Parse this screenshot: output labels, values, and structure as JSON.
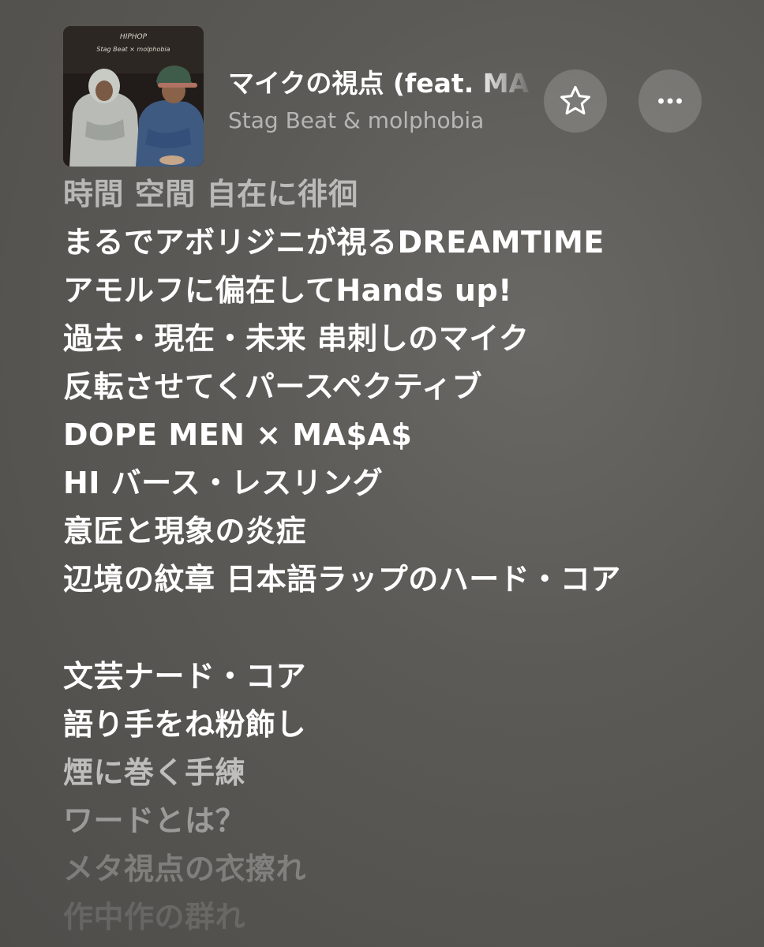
{
  "now_playing": {
    "title": "マイクの視点 (feat. MA",
    "artist": "Stag Beat & molphobia",
    "artwork_caption": "HIPHOP",
    "artwork_caption_2": "Stag Beat × molphobia"
  },
  "controls": {
    "favorite_icon": "star-outline-icon",
    "more_icon": "ellipsis-icon"
  },
  "colors": {
    "background": "#5c5a56",
    "button_bg": "rgba(255,255,255,0.17)",
    "active_text": "#ffffff",
    "secondary_text": "rgba(255,255,255,0.55)"
  },
  "lyrics": {
    "verse1": [
      "時間 空間 自在に徘徊",
      "まるでアボリジニが視るDREAMTIME",
      "アモルフに偏在してHands up!",
      "過去・現在・未来 串刺しのマイク",
      "反転させてくパースペクティブ",
      "DOPE MEN × MA$A$",
      "HI バース・レスリング",
      "意匠と現象の炎症",
      "辺境の紋章 日本語ラップのハード・コア"
    ],
    "verse2": [
      "文芸ナード・コア",
      "語り手をね粉飾し",
      "煙に巻く手練",
      "ワードとは？",
      "メタ視点の衣擦れ",
      "作中作の群れ"
    ]
  }
}
